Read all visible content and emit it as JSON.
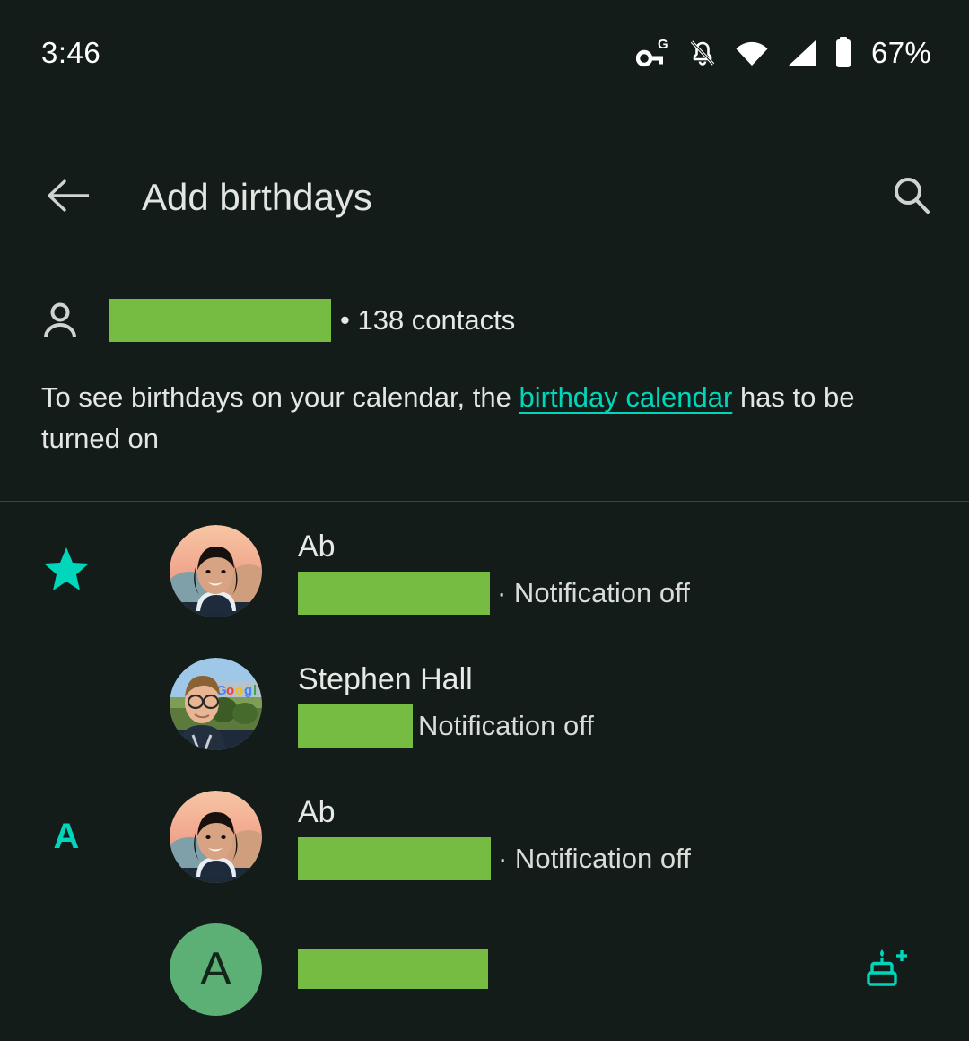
{
  "status_bar": {
    "time": "3:46",
    "battery_percent": "67%",
    "icons": [
      "vpn-key-g-icon",
      "notifications-off-icon",
      "wifi-icon",
      "cellular-signal-icon",
      "battery-icon"
    ]
  },
  "app_bar": {
    "back_label": "back-arrow",
    "title": "Add birthdays",
    "search_label": "search"
  },
  "account": {
    "name_redacted": "",
    "contacts_label": "• 138 contacts"
  },
  "info": {
    "text_before": "To see birthdays on your calendar, the ",
    "link_text": "birthday calendar",
    "text_after": " has to be turned on"
  },
  "contacts": [
    {
      "section": "★",
      "section_type": "star",
      "name": "Ab",
      "name_redacted": "",
      "subtitle": "· Notification off",
      "avatar_type": "photo-sunset-portrait",
      "has_cake_button": false
    },
    {
      "section": "",
      "section_type": "none",
      "name": "Stephen Hall",
      "name_redacted": "",
      "subtitle": "Notification off",
      "avatar_type": "photo-google-sign",
      "has_cake_button": false
    },
    {
      "section": "A",
      "section_type": "letter",
      "name": "Ab",
      "name_redacted": "",
      "subtitle": "· Notification off",
      "avatar_type": "photo-sunset-portrait",
      "has_cake_button": false
    },
    {
      "section": "",
      "section_type": "none",
      "name": "",
      "name_redacted": "",
      "subtitle": "",
      "avatar_type": "monogram",
      "avatar_letter": "A",
      "has_cake_button": true,
      "cake_label": "add-birthday"
    }
  ],
  "colors": {
    "background": "#131c18",
    "accent_teal": "#00d6bc",
    "redaction_green": "#76bc43",
    "monogram_green": "#5cb075",
    "text_primary": "#e6e9e6",
    "divider": "#3a4641"
  }
}
